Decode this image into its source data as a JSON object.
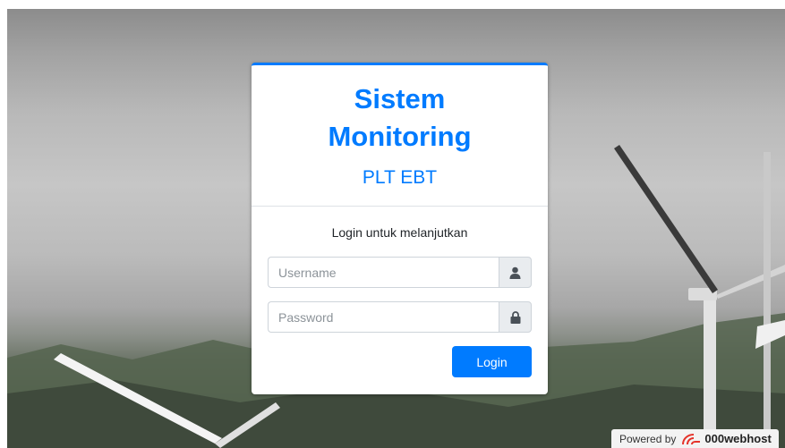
{
  "header": {
    "title": "Sistem Monitoring",
    "subtitle": "PLT EBT"
  },
  "login": {
    "message": "Login untuk melanjutkan",
    "username_placeholder": "Username",
    "password_placeholder": "Password",
    "username_icon": "user-icon",
    "password_icon": "lock-icon",
    "button_label": "Login"
  },
  "footer": {
    "powered_by": "Powered by",
    "brand": "000webhost",
    "logo_icon": "000webhost-logo-icon"
  },
  "colors": {
    "primary": "#007bff",
    "addon_bg": "#e9ecef",
    "brand_red": "#e5332a"
  }
}
